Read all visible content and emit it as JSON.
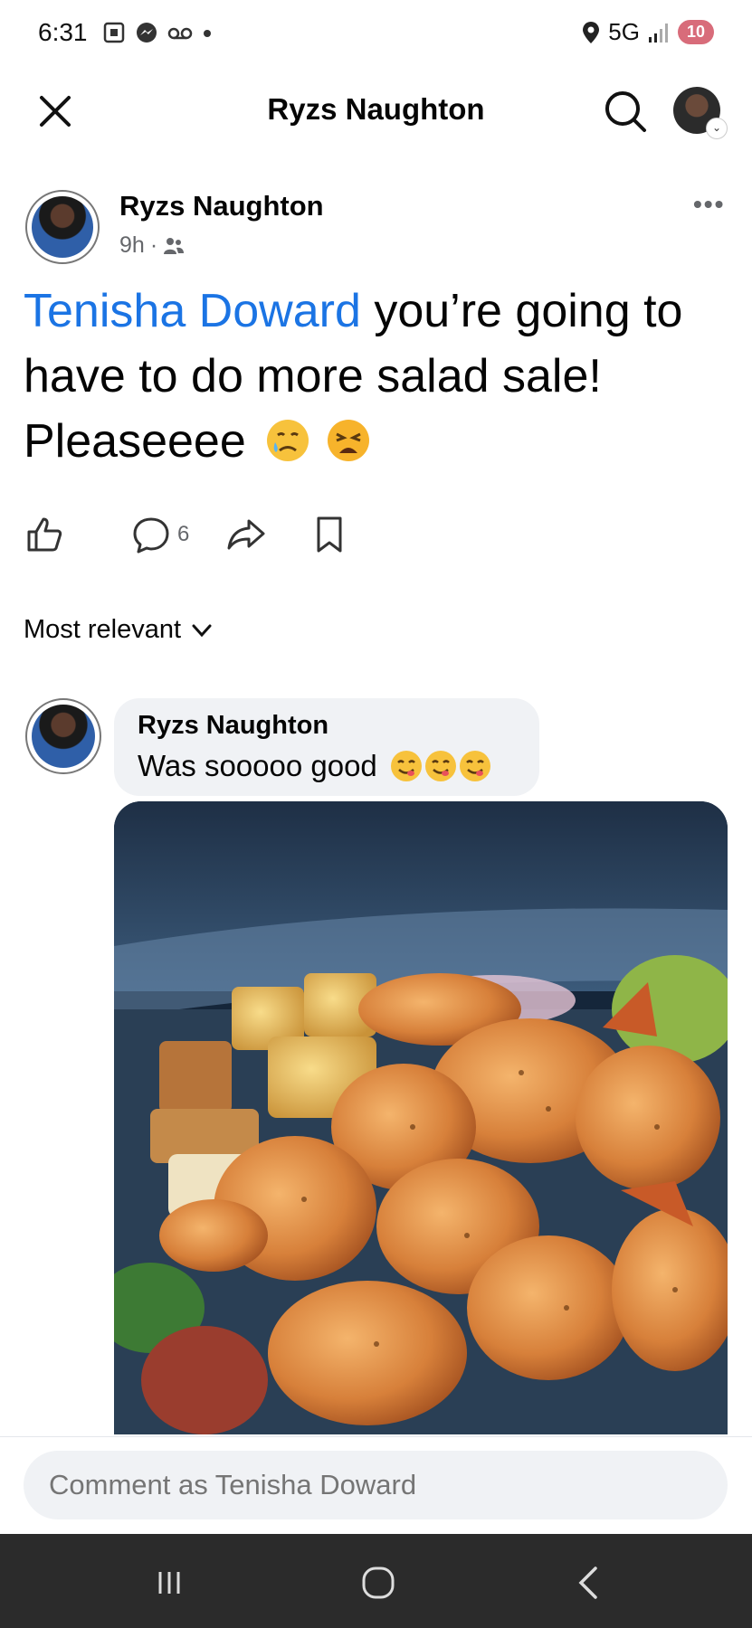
{
  "status_bar": {
    "time": "6:31",
    "network": "5G",
    "battery": "10",
    "icons": [
      "screenshot-icon",
      "messenger-icon",
      "voicemail-icon",
      "dot-icon",
      "location-icon",
      "signal-icon",
      "battery-icon"
    ]
  },
  "header": {
    "title": "Ryzs Naughton",
    "icons": [
      "close-icon",
      "search-icon",
      "profile-avatar"
    ]
  },
  "post": {
    "author": "Ryzs Naughton",
    "time": "9h",
    "separator": "·",
    "audience_icon": "friends-icon",
    "mention": "Tenisha Doward",
    "text": " you’re going to have to do more salad sale! Pleaseeee",
    "emojis": [
      "sad-relieved-face-emoji",
      "weary-face-emoji"
    ],
    "comment_count": "6",
    "actions": [
      "like-icon",
      "comment-icon",
      "share-icon",
      "save-icon"
    ]
  },
  "comments": {
    "sort_label": "Most relevant",
    "items": [
      {
        "author": "Ryzs Naughton",
        "text": "Was sooooo good",
        "emojis": [
          "yum-face-emoji",
          "yum-face-emoji",
          "yum-face-emoji"
        ],
        "photo": "shrimp salad in a plastic container"
      }
    ]
  },
  "composer": {
    "placeholder": "Comment as Tenisha Doward"
  },
  "nav": {
    "buttons": [
      "recent-apps-icon",
      "home-icon",
      "back-icon"
    ]
  },
  "colors": {
    "mention_blue": "#1b74e4",
    "bubble_gray": "#f0f2f5",
    "secondary_text": "#65676b",
    "nav_bar": "#2b2b2b"
  }
}
